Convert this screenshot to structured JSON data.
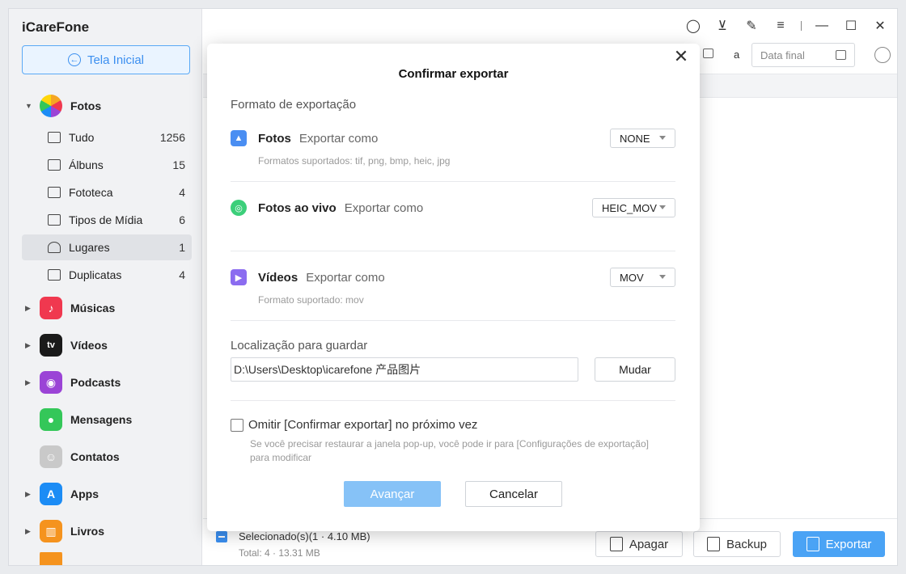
{
  "app": {
    "title": "iCareFone"
  },
  "sidebar": {
    "home_label": "Tela Inicial",
    "categories": [
      {
        "label": "Fotos",
        "color": "#f5a623"
      },
      {
        "label": "Músicas",
        "color": "#f0384f"
      },
      {
        "label": "Vídeos",
        "color": "#1a1a1a"
      },
      {
        "label": "Podcasts",
        "color": "#9b44d6"
      },
      {
        "label": "Mensagens",
        "color": "#34c759"
      },
      {
        "label": "Contatos",
        "color": "#b6b6b6"
      },
      {
        "label": "Apps",
        "color": "#1c8cf5"
      },
      {
        "label": "Livros",
        "color": "#f5931e"
      }
    ],
    "photos_sub": [
      {
        "label": "Tudo",
        "count": "1256"
      },
      {
        "label": "Álbuns",
        "count": "15"
      },
      {
        "label": "Fototeca",
        "count": "4"
      },
      {
        "label": "Tipos de Mídia",
        "count": "6"
      },
      {
        "label": "Lugares",
        "count": "1"
      },
      {
        "label": "Duplicatas",
        "count": "4"
      }
    ],
    "active_item": "Lugares"
  },
  "toolbar": {
    "date_separator": "a",
    "end_date_placeholder": "Data final"
  },
  "footer": {
    "selected": "Selecionado(s)(1 · 4.10 MB)",
    "total": "Total: 4 · 13.31 MB",
    "delete_label": "Apagar",
    "backup_label": "Backup",
    "export_label": "Exportar"
  },
  "modal": {
    "title": "Confirmar exportar",
    "format_section": "Formato de exportação",
    "rows": [
      {
        "name": "Fotos",
        "sub": "Exportar como",
        "value": "NONE",
        "hint": "Formatos suportados: tif, png, bmp, heic, jpg",
        "icon": "photo-icon",
        "color": "#4a8ef2"
      },
      {
        "name": "Fotos ao vivo",
        "sub": "Exportar como",
        "value": "HEIC_MOV",
        "hint": "",
        "icon": "live-photo-icon",
        "color": "#3ccf7a"
      },
      {
        "name": "Vídeos",
        "sub": "Exportar como",
        "value": "MOV",
        "hint": "Formato suportado: mov",
        "icon": "video-icon",
        "color": "#8b6cf0"
      }
    ],
    "location_label": "Localização para guardar",
    "path_value": "D:\\Users\\Desktop\\icarefone 产品图片",
    "change_label": "Mudar",
    "skip_label": "Omitir [Confirmar exportar] no próximo vez",
    "skip_hint": "Se você precisar restaurar a janela pop-up, você pode ir para [Configurações de exportação] para modificar",
    "next_label": "Avançar",
    "cancel_label": "Cancelar"
  }
}
